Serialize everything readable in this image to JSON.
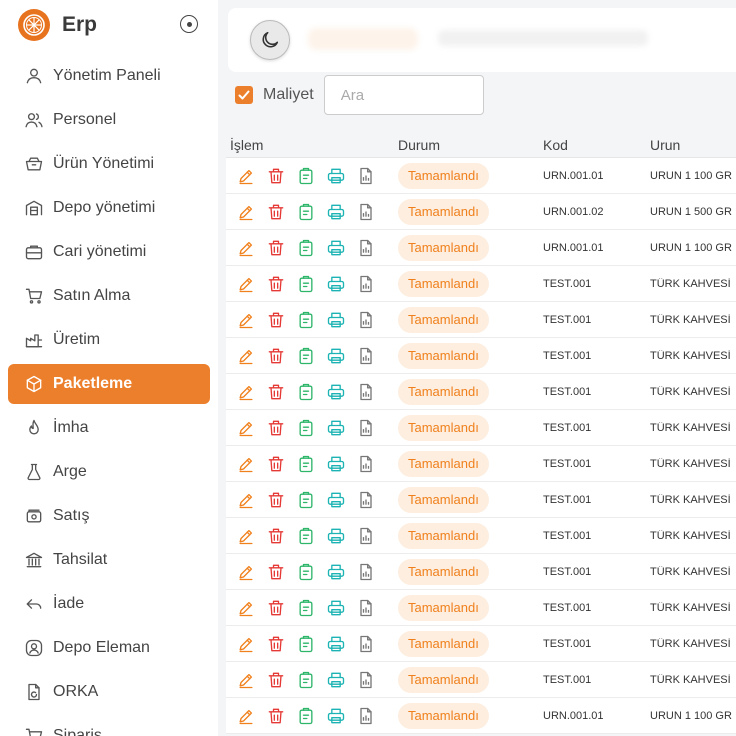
{
  "brand": {
    "name": "Erp",
    "accent": "#ec7f2c"
  },
  "sidebar": {
    "items": [
      {
        "label": "Yönetim Paneli",
        "icon": "user-icon"
      },
      {
        "label": "Personel",
        "icon": "users-icon"
      },
      {
        "label": "Ürün Yönetimi",
        "icon": "box-icon"
      },
      {
        "label": "Depo yönetimi",
        "icon": "warehouse-icon"
      },
      {
        "label": "Cari yönetimi",
        "icon": "briefcase-icon"
      },
      {
        "label": "Satın Alma",
        "icon": "cart-icon"
      },
      {
        "label": "Üretim",
        "icon": "factory-icon"
      },
      {
        "label": "Paketleme",
        "icon": "package-icon",
        "active": true
      },
      {
        "label": "İmha",
        "icon": "flame-icon"
      },
      {
        "label": "Arge",
        "icon": "flask-icon"
      },
      {
        "label": "Satış",
        "icon": "cash-icon"
      },
      {
        "label": "Tahsilat",
        "icon": "bank-icon"
      },
      {
        "label": "İade",
        "icon": "return-icon"
      },
      {
        "label": "Depo Eleman",
        "icon": "user-circle-icon"
      },
      {
        "label": "ORKA",
        "icon": "file-refresh-icon"
      },
      {
        "label": "Siparis",
        "icon": "cart-icon"
      }
    ]
  },
  "filters": {
    "checkbox_label": "Maliyet",
    "checked": true,
    "search_placeholder": "Ara"
  },
  "table": {
    "headers": {
      "islem": "İşlem",
      "durum": "Durum",
      "kod": "Kod",
      "urun": "Urun"
    },
    "rows": [
      {
        "durum": "Tamamlandı",
        "kod": "URN.001.01",
        "urun": "URUN 1 100 GR"
      },
      {
        "durum": "Tamamlandı",
        "kod": "URN.001.02",
        "urun": "URUN 1 500 GR"
      },
      {
        "durum": "Tamamlandı",
        "kod": "URN.001.01",
        "urun": "URUN 1 100 GR"
      },
      {
        "durum": "Tamamlandı",
        "kod": "TEST.001",
        "urun": "TÜRK KAHVESİ"
      },
      {
        "durum": "Tamamlandı",
        "kod": "TEST.001",
        "urun": "TÜRK KAHVESİ"
      },
      {
        "durum": "Tamamlandı",
        "kod": "TEST.001",
        "urun": "TÜRK KAHVESİ"
      },
      {
        "durum": "Tamamlandı",
        "kod": "TEST.001",
        "urun": "TÜRK KAHVESİ"
      },
      {
        "durum": "Tamamlandı",
        "kod": "TEST.001",
        "urun": "TÜRK KAHVESİ"
      },
      {
        "durum": "Tamamlandı",
        "kod": "TEST.001",
        "urun": "TÜRK KAHVESİ"
      },
      {
        "durum": "Tamamlandı",
        "kod": "TEST.001",
        "urun": "TÜRK KAHVESİ"
      },
      {
        "durum": "Tamamlandı",
        "kod": "TEST.001",
        "urun": "TÜRK KAHVESİ"
      },
      {
        "durum": "Tamamlandı",
        "kod": "TEST.001",
        "urun": "TÜRK KAHVESİ"
      },
      {
        "durum": "Tamamlandı",
        "kod": "TEST.001",
        "urun": "TÜRK KAHVESİ"
      },
      {
        "durum": "Tamamlandı",
        "kod": "TEST.001",
        "urun": "TÜRK KAHVESİ"
      },
      {
        "durum": "Tamamlandı",
        "kod": "TEST.001",
        "urun": "TÜRK KAHVESİ"
      },
      {
        "durum": "Tamamlandı",
        "kod": "URN.001.01",
        "urun": "URUN 1 100 GR"
      }
    ],
    "action_icons": [
      "edit-icon",
      "trash-icon",
      "clipboard-icon",
      "printer-icon",
      "file-icon"
    ],
    "action_colors": [
      "#f0801c",
      "#e53935",
      "#2db56a",
      "#1bb3b3",
      "#777777"
    ]
  }
}
